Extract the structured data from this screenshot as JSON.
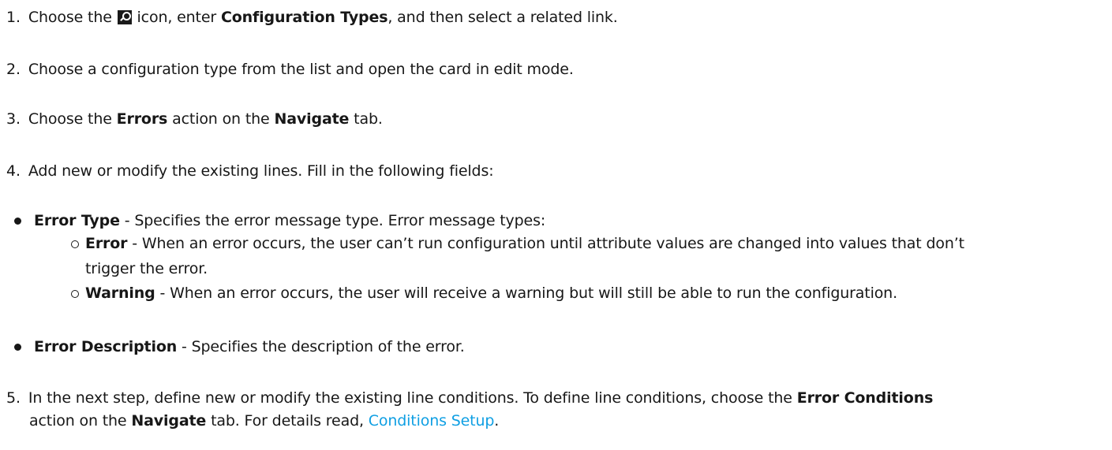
{
  "steps": {
    "s1": {
      "num": "1.",
      "a": "Choose the",
      "b": "icon, enter",
      "c": "Configuration Types",
      "d": ", and then select a related link."
    },
    "s2": {
      "num": "2.",
      "text": "Choose a configuration type from the list and open the card in edit mode."
    },
    "s3": {
      "num": "3.",
      "a": "Choose the",
      "b": "Errors",
      "c": "action on the",
      "d": "Navigate",
      "e": "tab."
    },
    "s4": {
      "num": "4.",
      "text": "Add new or modify the existing lines. Fill in the following fields:"
    },
    "s5": {
      "num": "5.",
      "line1a": "In the next step, define new or modify the existing line conditions. To define line conditions, choose the",
      "line1b": "Error Conditions",
      "line2a": "action on the",
      "line2b": "Navigate",
      "line2c": "tab. For details read,",
      "link": "Conditions Setup",
      "line2d": "."
    }
  },
  "fields": {
    "error_type": {
      "label": "Error Type",
      "text": "- Specifies the error message type. Error message types:"
    },
    "sub_error": {
      "label": "Error",
      "line1": "- When an error occurs, the user can’t run configuration until attribute values are changed into values that don’t",
      "line2": "trigger the error."
    },
    "sub_warning": {
      "label": "Warning",
      "text": "- When an error occurs, the user will receive a warning but will still be able to run the configuration."
    },
    "error_description": {
      "label": "Error Description",
      "text": "- Specifies the description of the error."
    }
  }
}
